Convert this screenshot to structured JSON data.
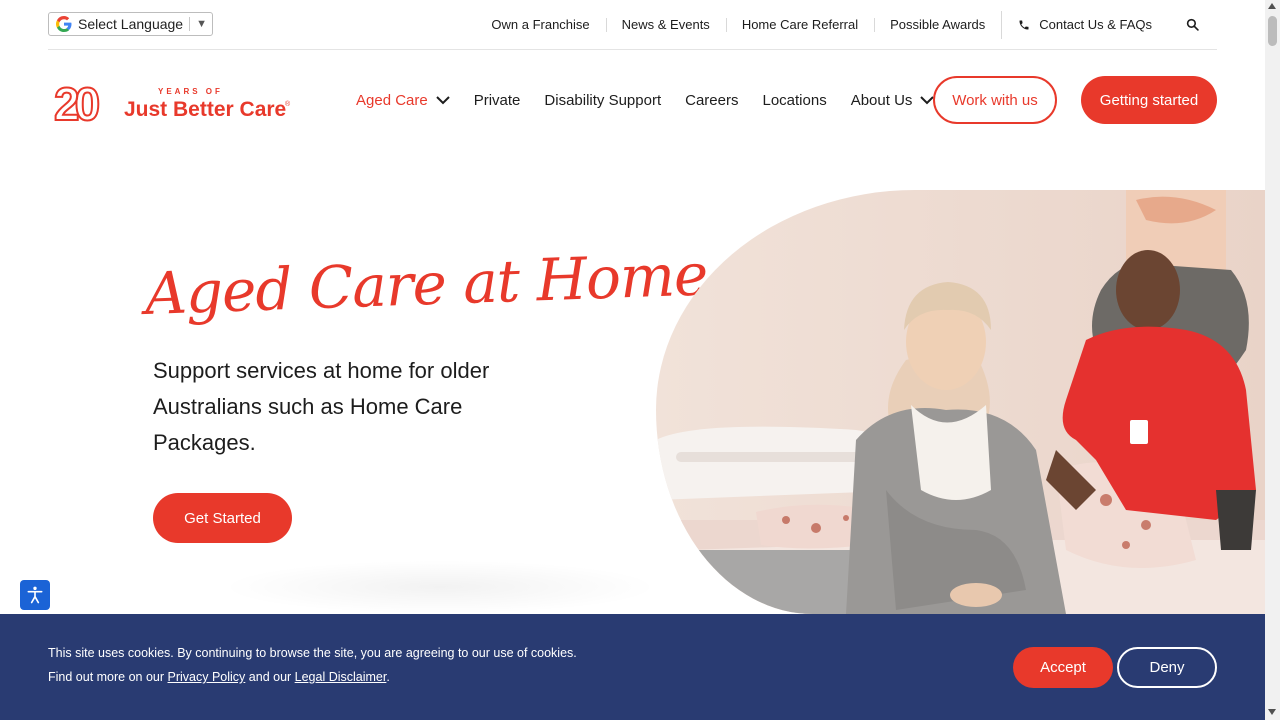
{
  "colors": {
    "brand_red": "#e8392b",
    "cookie_bg": "#293b72",
    "a11y_blue": "#1b63d6"
  },
  "utility": {
    "language_label": "Select Language",
    "links": [
      "Own a Franchise",
      "News & Events",
      "Home Care Referral",
      "Possible Awards"
    ],
    "contact_label": "Contact Us & FAQs",
    "icons": {
      "language": "google-g-icon",
      "contact": "phone-icon",
      "search": "search-icon"
    }
  },
  "logo": {
    "number": "20",
    "tagline_top": "YEARS OF",
    "brand": "Just Better Care",
    "mark": "®"
  },
  "nav": {
    "items": [
      "Aged Care",
      "Private",
      "Disability Support",
      "Careers",
      "Locations",
      "About Us"
    ],
    "active": "Aged Care",
    "work_button": "Work with us",
    "start_button": "Getting started"
  },
  "hero": {
    "title": "Aged Care at Home",
    "text": "Support services at home for older Australians such as Home Care Packages.",
    "button": "Get Started",
    "image": "photo of a smiling carer in a red shirt helping an elderly woman in a grey robe sitting on a bed"
  },
  "cookie": {
    "line1": "This site uses cookies. By continuing to browse the site, you are agreeing to our use of cookies.",
    "line2_prefix": "Find out more on our ",
    "privacy_link": "Privacy Policy",
    "line2_mid": " and our ",
    "legal_link": "Legal Disclaimer",
    "line2_suffix": ".",
    "accept": "Accept",
    "deny": "Deny"
  }
}
